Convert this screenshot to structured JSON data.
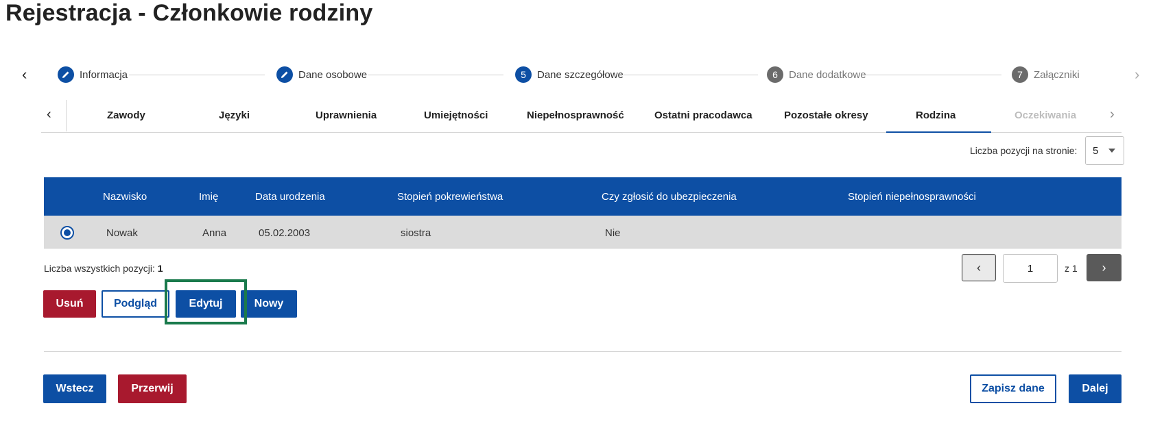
{
  "page": {
    "title": "Rejestracja - Członkowie rodziny"
  },
  "stepper": {
    "steps": [
      {
        "label": "Informacja",
        "marker": "pencil-icon"
      },
      {
        "label": "Dane osobowe",
        "marker": "pencil-icon"
      },
      {
        "label": "Dane szczegółowe",
        "number": "5",
        "active": true
      },
      {
        "label": "Dane dodatkowe",
        "number": "6"
      },
      {
        "label": "Załączniki",
        "number": "7"
      }
    ]
  },
  "tabs": {
    "items": [
      {
        "label": "Zawody"
      },
      {
        "label": "Języki"
      },
      {
        "label": "Uprawnienia"
      },
      {
        "label": "Umiejętności"
      },
      {
        "label": "Niepełnosprawność"
      },
      {
        "label": "Ostatni pracodawca"
      },
      {
        "label": "Pozostałe okresy"
      },
      {
        "label": "Rodzina",
        "active": true
      },
      {
        "label": "Oczekiwania",
        "disabled": true
      }
    ]
  },
  "per_page": {
    "label": "Liczba pozycji na stronie:",
    "value": "5"
  },
  "table": {
    "columns": [
      "Nazwisko",
      "Imię",
      "Data urodzenia",
      "Stopień pokrewieństwa",
      "Czy zgłosić do ubezpieczenia",
      "Stopień niepełnosprawności"
    ],
    "rows": [
      {
        "selected": true,
        "cells": [
          "Nowak",
          "Anna",
          "05.02.2003",
          "siostra",
          "Nie",
          ""
        ]
      }
    ]
  },
  "total": {
    "label": "Liczba wszystkich pozycji:",
    "value": "1"
  },
  "pagination": {
    "current": "1",
    "of_label": "z 1"
  },
  "actions": {
    "delete": "Usuń",
    "preview": "Podgląd",
    "edit": "Edytuj",
    "new": "Nowy"
  },
  "footer": {
    "back": "Wstecz",
    "abort": "Przerwij",
    "save": "Zapisz dane",
    "next": "Dalej"
  },
  "colors": {
    "primary": "#0d4fa4",
    "danger": "#a8192e",
    "highlight": "#1a7a4c",
    "row_selected": "#dcdcdc"
  }
}
